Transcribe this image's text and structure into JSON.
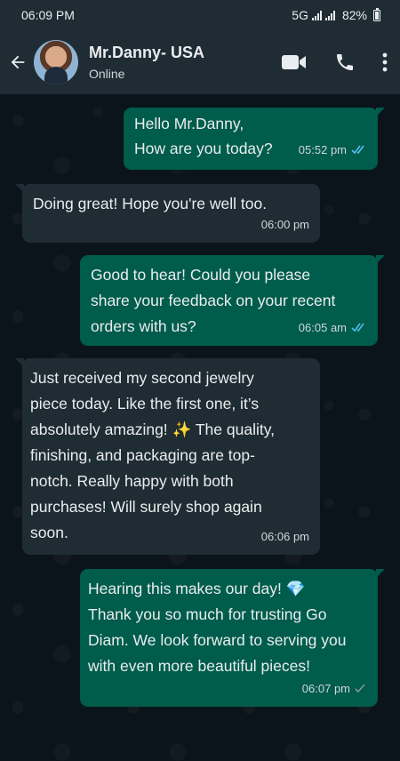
{
  "status_bar": {
    "time": "06:09 PM",
    "network": "5G",
    "battery": "82%"
  },
  "header": {
    "contact_name": "Mr.Danny- USA",
    "contact_status": "Online"
  },
  "messages": [
    {
      "direction": "out",
      "text": "Hello Mr.Danny,\nHow are you today?",
      "time": "05:52 pm",
      "status": "read"
    },
    {
      "direction": "in",
      "text": "Doing great! Hope you're well too.",
      "time": "06:00 pm"
    },
    {
      "direction": "out",
      "text": "Good to hear! Could you please\nshare your feedback on your recent\norders with us?",
      "time": "06:05 am",
      "status": "read"
    },
    {
      "direction": "in",
      "text": " Just received my second jewelry\npiece today. Like the first one, it’s\nabsolutely amazing! ✨ The quality,\nfinishing, and packaging are top-\nnotch. Really happy with both\npurchases! Will surely shop again\nsoon.",
      "time": "06:06 pm"
    },
    {
      "direction": "out",
      "text": "Hearing this makes our day! 💎\nThank you so much for trusting Go\nDiam. We look forward to serving you\nwith even more beautiful pieces!",
      "time": "06:07 pm",
      "status": "sent"
    }
  ],
  "colors": {
    "outgoing": "#005c4b",
    "incoming": "#202c33",
    "read_tick": "#53bdeb",
    "header": "#1f2c34"
  }
}
